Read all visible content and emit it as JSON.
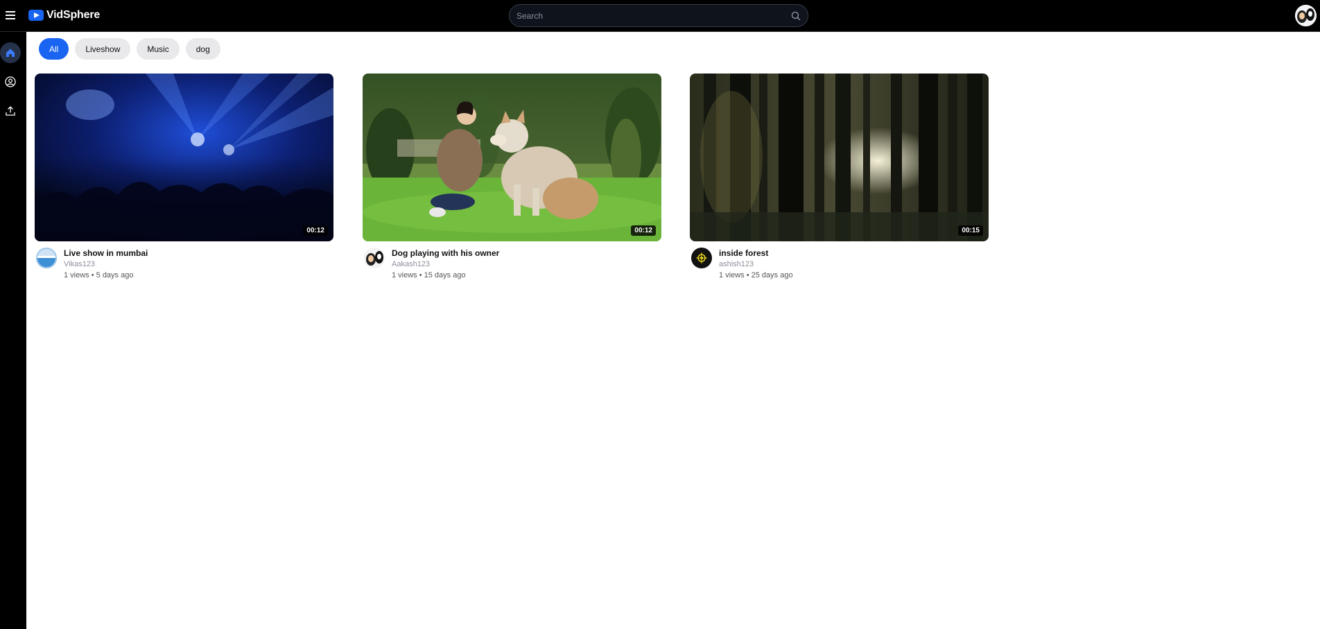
{
  "app": {
    "title": "VidSphere"
  },
  "search": {
    "placeholder": "Search"
  },
  "chips": [
    "All",
    "Liveshow",
    "Music",
    "dog"
  ],
  "videos": [
    {
      "title": "Live show in mumbai",
      "channel": "Vikas123",
      "stats": "1 views • 5 days ago",
      "duration": "00:12"
    },
    {
      "title": "Dog playing with his owner",
      "channel": "Aakash123",
      "stats": "1 views • 15 days ago",
      "duration": "00:12"
    },
    {
      "title": "inside forest",
      "channel": "ashish123",
      "stats": "1 views • 25 days ago",
      "duration": "00:15"
    }
  ],
  "colors": {
    "accent": "#1a64f2",
    "topbar": "#000000",
    "chip": "#e9e9ec"
  }
}
